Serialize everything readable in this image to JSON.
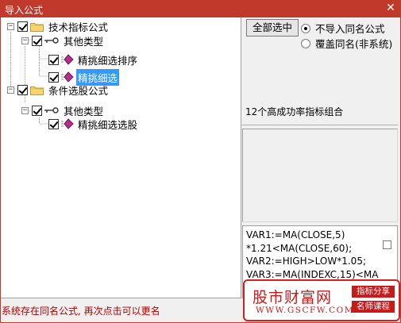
{
  "window": {
    "title": "导入公式",
    "close_glyph": "✕"
  },
  "tree": {
    "expander_glyph": "−",
    "nodes": {
      "n0": {
        "label": "技术指标公式",
        "icon": "folder-icon"
      },
      "n1": {
        "label": "其他类型",
        "icon": "key-icon"
      },
      "n2": {
        "label": "精挑细选排序",
        "icon": "formula-icon"
      },
      "n3": {
        "label": "精挑细选",
        "icon": "formula-icon",
        "selected": true
      },
      "n4": {
        "label": "条件选股公式",
        "icon": "folder-icon"
      },
      "n5": {
        "label": "其他类型",
        "icon": "key-icon"
      },
      "n6": {
        "label": "精挑细选选股",
        "icon": "formula-icon"
      }
    }
  },
  "controls": {
    "select_all": "全部选中",
    "radio_no_import": "不导入同名公式",
    "radio_overwrite": "覆盖同名(非系统)",
    "selected_option": "radio_no_import"
  },
  "description": "12个高成功率指标组合",
  "code_lines": [
    "VAR1:=MA(CLOSE,5)",
    "*1.21<MA(CLOSE,60);",
    "VAR2:=HIGH>LOW*1.05;",
    "VAR3:=MA(INDEXC,15)<MA"
  ],
  "status_text": "系统存在同名公式, 再次点击可以更名",
  "watermark": {
    "title": "股市财富网",
    "url": "WWW.GSCFW.COM",
    "tag1": "指标分享",
    "tag2": "名师课程"
  },
  "colors": {
    "titlebar": "#c0392b",
    "selection": "#3399ff",
    "status_text": "#b00000",
    "watermark": "#c71a1a"
  }
}
